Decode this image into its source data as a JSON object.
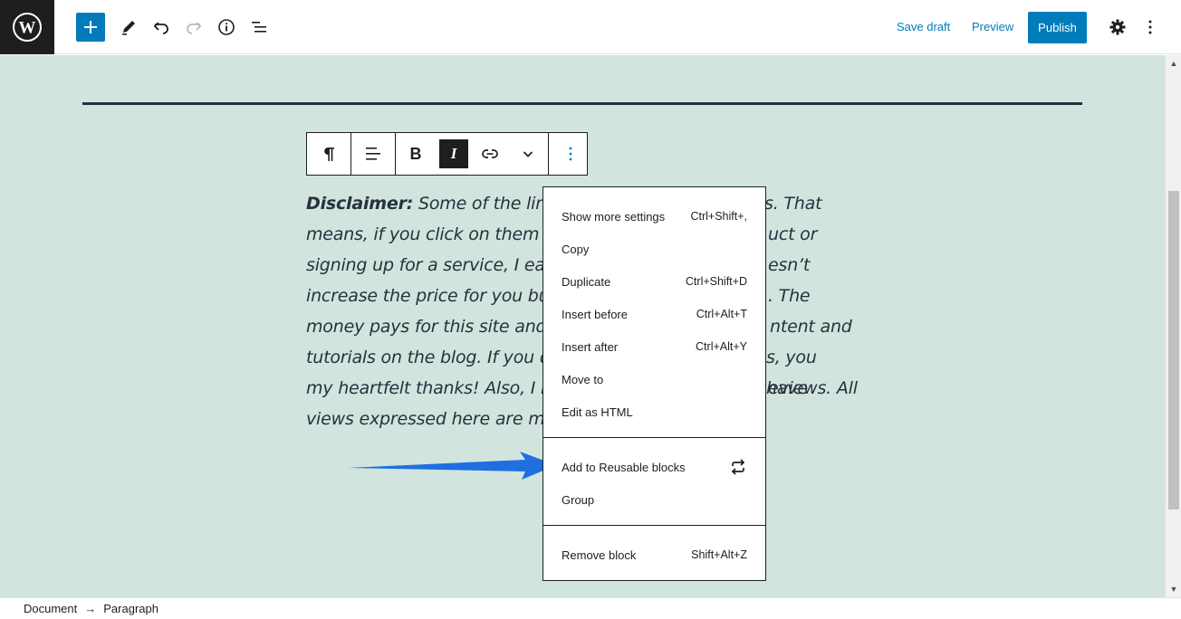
{
  "topbar": {
    "save_draft": "Save draft",
    "preview": "Preview",
    "publish": "Publish"
  },
  "colors": {
    "accent": "#007cba",
    "canvas_bg": "#d1e4dd",
    "dark": "#1e1e1e",
    "arrow": "#1f6fe0"
  },
  "block_toolbar": {
    "bold": "B",
    "italic": "I"
  },
  "paragraph": {
    "lead": "Disclaimer:",
    "lines": [
      " Some of the links ",
      "s. That",
      "means, if you click on them an",
      "uct or",
      "signing up for a service, I earn",
      "esn’t",
      "increase the price for you but i",
      ". The",
      "money pays for this site and e",
      "ntent and",
      "tutorials on the blog. If you do",
      "s, you have",
      "my heartfelt thanks! Also, I ne",
      "eviews. All",
      "views expressed here are my h"
    ]
  },
  "menu": {
    "group1": [
      {
        "label": "Show more settings",
        "shortcut": "Ctrl+Shift+,"
      },
      {
        "label": "Copy",
        "shortcut": ""
      },
      {
        "label": "Duplicate",
        "shortcut": "Ctrl+Shift+D"
      },
      {
        "label": "Insert before",
        "shortcut": "Ctrl+Alt+T"
      },
      {
        "label": "Insert after",
        "shortcut": "Ctrl+Alt+Y"
      },
      {
        "label": "Move to",
        "shortcut": ""
      },
      {
        "label": "Edit as HTML",
        "shortcut": ""
      }
    ],
    "group2": [
      {
        "label": "Add to Reusable blocks",
        "icon": "reusable-block-icon"
      },
      {
        "label": "Group"
      }
    ],
    "group3": [
      {
        "label": "Remove block",
        "shortcut": "Shift+Alt+Z"
      }
    ]
  },
  "footer": {
    "crumb1": "Document",
    "sep": "→",
    "crumb2": "Paragraph"
  }
}
